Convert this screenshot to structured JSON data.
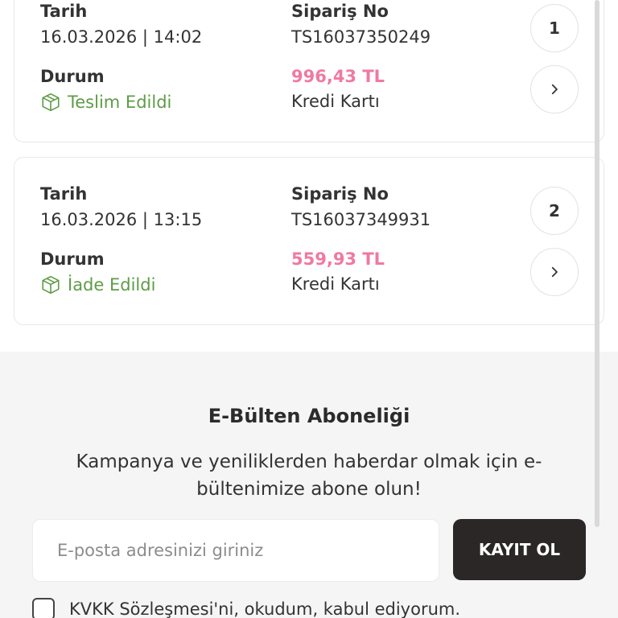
{
  "orders": [
    {
      "date_label": "Tarih",
      "date_value": "16.03.2026 | 14:02",
      "order_no_label": "Sipariş No",
      "order_no_value": "TS16037350249",
      "status_label": "Durum",
      "status_value": "Teslim Edildi",
      "amount": "996,43 TL",
      "payment": "Kredi Kartı",
      "index": "1"
    },
    {
      "date_label": "Tarih",
      "date_value": "16.03.2026 | 13:15",
      "order_no_label": "Sipariş No",
      "order_no_value": "TS16037349931",
      "status_label": "Durum",
      "status_value": "İade Edildi",
      "amount": "559,93 TL",
      "payment": "Kredi Kartı",
      "index": "2"
    }
  ],
  "newsletter": {
    "title": "E-Bülten Aboneliği",
    "description": "Kampanya ve yeniliklerden haberdar olmak için e-bültenimize abone olun!",
    "email_placeholder": "E-posta adresinizi giriniz",
    "submit_label": "KAYIT OL",
    "kvkk_text": "KVKK Sözleşmesi'ni, okudum, kabul ediyorum."
  },
  "icons": {
    "status": "box-icon",
    "details": "chevron-right-icon"
  },
  "colors": {
    "status_green": "#5e9c46",
    "amount_pink": "#ef7aa0",
    "button_dark": "#2a2726"
  }
}
